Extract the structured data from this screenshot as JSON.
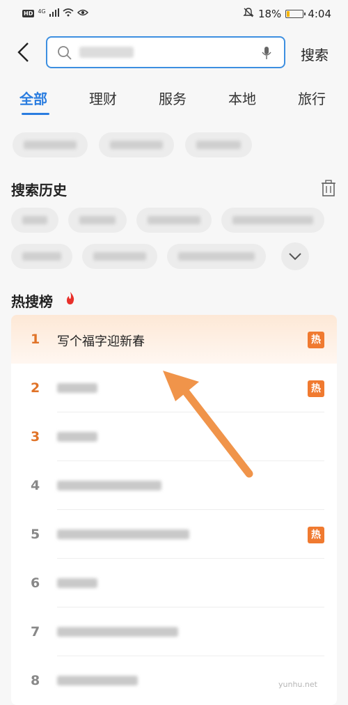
{
  "status_bar": {
    "network": "4G",
    "hd_label": "HD",
    "battery": "18%",
    "time": "4:04"
  },
  "search": {
    "button_label": "搜索"
  },
  "tabs": [
    "全部",
    "理财",
    "服务",
    "本地",
    "旅行"
  ],
  "history": {
    "title": "搜索历史"
  },
  "hot": {
    "title": "热搜榜",
    "items": [
      {
        "rank": "1",
        "title": "写个福字迎新春",
        "badge": "热"
      },
      {
        "rank": "2",
        "badge": "热"
      },
      {
        "rank": "3"
      },
      {
        "rank": "4"
      },
      {
        "rank": "5",
        "badge": "热"
      },
      {
        "rank": "6"
      },
      {
        "rank": "7"
      },
      {
        "rank": "8"
      }
    ]
  },
  "watermark": "yunhu.net",
  "colors": {
    "accent": "#2a7de0",
    "hot_orange": "#f07a30",
    "arrow": "#f0944a"
  }
}
